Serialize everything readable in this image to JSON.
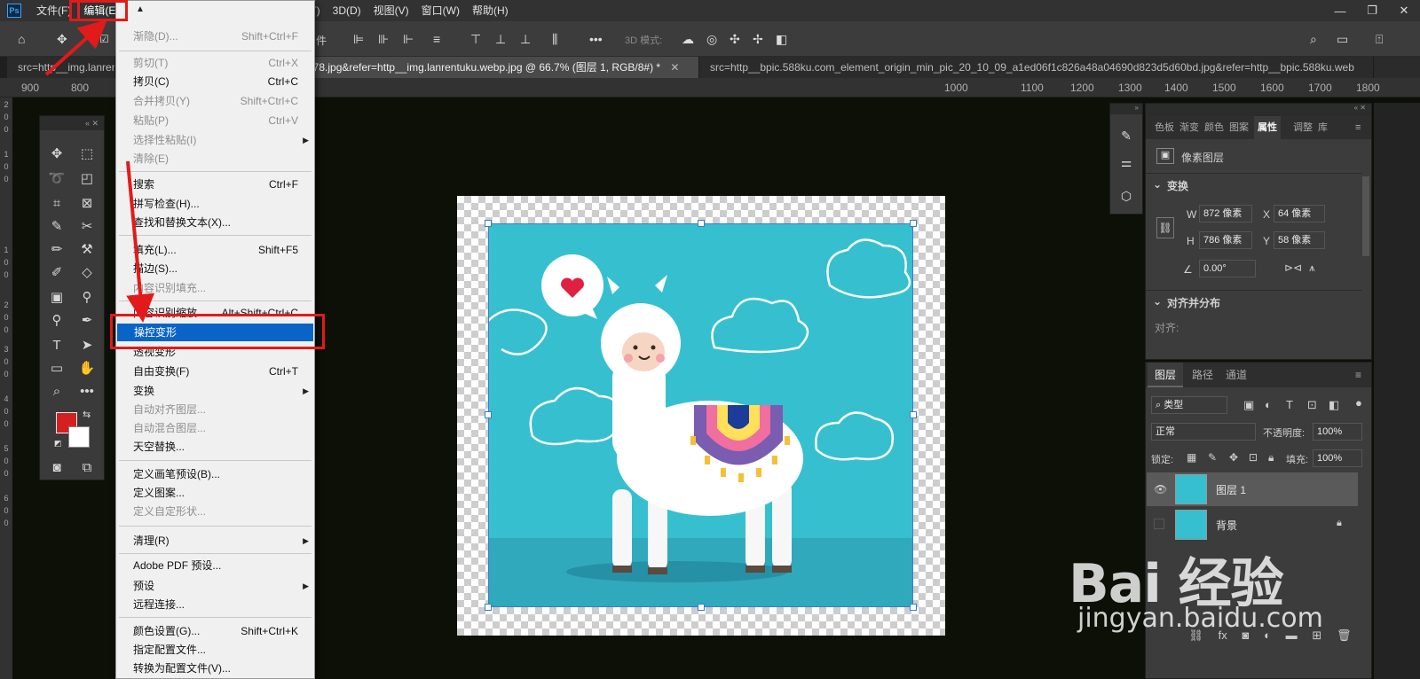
{
  "menubar": {
    "logo": "Ps",
    "items": [
      "文件(F)",
      "编辑(E)",
      "",
      "",
      "",
      "",
      "",
      "",
      "3D(D)",
      "视图(V)",
      "窗口(W)",
      "帮助(H)"
    ],
    "visible_items": {
      "file": "文件(F)",
      "edit": "编辑(E)",
      "type_partial": "(T)",
      "threed": "3D(D)",
      "view": "视图(V)",
      "window": "窗口(W)",
      "help": "帮助(H)"
    },
    "window_controls": [
      "—",
      "❐",
      "✕"
    ]
  },
  "options_bar": {
    "mode_label": "3D 模式:",
    "partial_label": "件"
  },
  "doc_tabs": [
    {
      "title": "src=http__img.lanren",
      "active": false
    },
    {
      "title": "778.jpg&refer=http__img.lanrentuku.webp.jpg @ 66.7% (图层 1, RGB/8#) *",
      "active": true,
      "close": "✕"
    },
    {
      "title": "src=http__bpic.588ku.com_element_origin_min_pic_20_10_09_a1ed06f1c826a48a04690d823d5d60bd.jpg&refer=http__bpic.588ku.web",
      "active": false
    }
  ],
  "ruler_top": [
    "900",
    "800",
    "1000",
    "1100",
    "1200",
    "1300",
    "1400",
    "1500",
    "1600",
    "1700",
    "1800"
  ],
  "ruler_left": [
    "2",
    "0",
    "0",
    "1",
    "0",
    "0",
    "1",
    "0",
    "0",
    "2",
    "0",
    "0",
    "3",
    "0",
    "0",
    "4",
    "0",
    "0",
    "5",
    "0",
    "0",
    "6",
    "0",
    "0"
  ],
  "edit_menu": {
    "items": [
      {
        "label": "渐隐(D)...",
        "shortcut": "Shift+Ctrl+F",
        "disabled": true
      },
      {
        "label": "剪切(T)",
        "shortcut": "Ctrl+X",
        "disabled": true
      },
      {
        "label": "拷贝(C)",
        "shortcut": "Ctrl+C",
        "disabled": false
      },
      {
        "label": "合并拷贝(Y)",
        "shortcut": "Shift+Ctrl+C",
        "disabled": true
      },
      {
        "label": "粘贴(P)",
        "shortcut": "Ctrl+V",
        "disabled": true
      },
      {
        "label": "选择性粘贴(I)",
        "shortcut": "",
        "disabled": true,
        "submenu": true
      },
      {
        "label": "清除(E)",
        "shortcut": "",
        "disabled": true
      },
      {
        "label": "搜索",
        "shortcut": "Ctrl+F",
        "disabled": false
      },
      {
        "label": "拼写检查(H)...",
        "shortcut": "",
        "disabled": false
      },
      {
        "label": "查找和替换文本(X)...",
        "shortcut": "",
        "disabled": false
      },
      {
        "label": "填充(L)...",
        "shortcut": "Shift+F5",
        "disabled": false
      },
      {
        "label": "描边(S)...",
        "shortcut": "",
        "disabled": false
      },
      {
        "label": "内容识别填充...",
        "shortcut": "",
        "disabled": true
      },
      {
        "label": "内容识别缩放",
        "shortcut": "Alt+Shift+Ctrl+C",
        "disabled": false
      },
      {
        "label": "操控变形",
        "shortcut": "",
        "disabled": false,
        "highlighted": true
      },
      {
        "label": "透视变形",
        "shortcut": "",
        "disabled": false
      },
      {
        "label": "自由变换(F)",
        "shortcut": "Ctrl+T",
        "disabled": false
      },
      {
        "label": "变换",
        "shortcut": "",
        "disabled": false,
        "submenu": true
      },
      {
        "label": "自动对齐图层...",
        "shortcut": "",
        "disabled": true
      },
      {
        "label": "自动混合图层...",
        "shortcut": "",
        "disabled": true
      },
      {
        "label": "天空替换...",
        "shortcut": "",
        "disabled": false
      },
      {
        "label": "定义画笔预设(B)...",
        "shortcut": "",
        "disabled": false
      },
      {
        "label": "定义图案...",
        "shortcut": "",
        "disabled": false
      },
      {
        "label": "定义自定形状...",
        "shortcut": "",
        "disabled": true
      },
      {
        "label": "清理(R)",
        "shortcut": "",
        "disabled": false,
        "submenu": true
      },
      {
        "label": "Adobe PDF 预设...",
        "shortcut": "",
        "disabled": false
      },
      {
        "label": "预设",
        "shortcut": "",
        "disabled": false,
        "submenu": true
      },
      {
        "label": "远程连接...",
        "shortcut": "",
        "disabled": false
      },
      {
        "label": "颜色设置(G)...",
        "shortcut": "Shift+Ctrl+K",
        "disabled": false
      },
      {
        "label": "指定配置文件...",
        "shortcut": "",
        "disabled": false
      },
      {
        "label": "转换为配置文件(V)...",
        "shortcut": "",
        "disabled": false
      }
    ]
  },
  "properties": {
    "tabs": [
      "色板",
      "渐变",
      "颜色",
      "图案",
      "属性",
      "调整",
      "库"
    ],
    "active_tab": "属性",
    "layer_type": "像素图层",
    "transform_title": "变换",
    "w_label": "W",
    "w_value": "872 像素",
    "h_label": "H",
    "h_value": "786 像素",
    "x_label": "X",
    "x_value": "64 像素",
    "y_label": "Y",
    "y_value": "58 像素",
    "angle_value": "0.00°",
    "align_title": "对齐并分布",
    "align_label": "对齐:"
  },
  "layers": {
    "tabs": [
      "图层",
      "路径",
      "通道"
    ],
    "active_tab": "图层",
    "filter": "类型",
    "blend_mode": "正常",
    "opacity_label": "不透明度:",
    "opacity_value": "100%",
    "lock_label": "锁定:",
    "fill_label": "填充:",
    "fill_value": "100%",
    "items": [
      {
        "name": "图层 1",
        "selected": true,
        "visible": true
      },
      {
        "name": "背景",
        "selected": false,
        "visible": false,
        "locked": true
      }
    ]
  },
  "watermark": {
    "logo": "Bai 经验",
    "url": "jingyan.baidu.com"
  },
  "colors": {
    "highlight": "#0a64c8",
    "annotation": "#e21a1a",
    "canvas_teal": "#36c0cf",
    "foreground": "#d42020",
    "background": "#ffffff"
  }
}
